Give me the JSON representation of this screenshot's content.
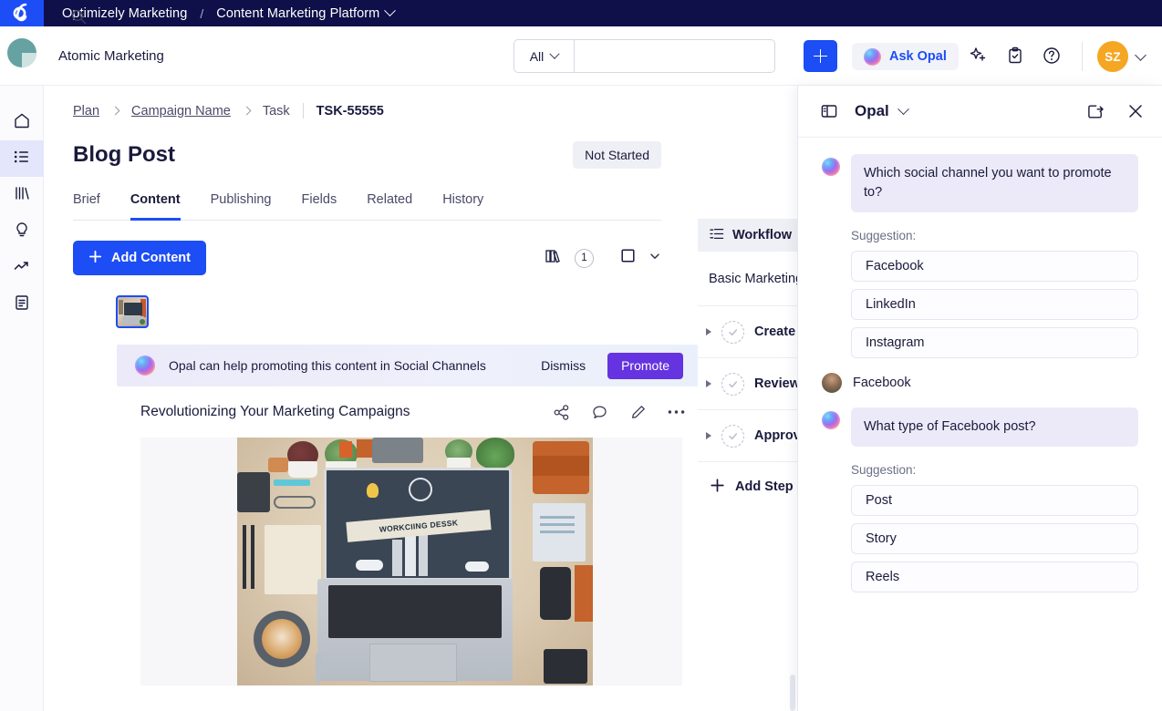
{
  "topnav": {
    "logo": "optimizely-logo",
    "org": "Optimizely Marketing",
    "separator": "/",
    "product": "Content Marketing Platform"
  },
  "appheader": {
    "workspace": "Atomic Marketing",
    "search": {
      "scope": "All",
      "value": "",
      "placeholder": ""
    },
    "add_label": "+",
    "ask_opal": "Ask Opal",
    "icons": [
      "sparkle-icon",
      "clipboard-check-icon",
      "help-circle-icon"
    ],
    "avatar_initials": "SZ"
  },
  "rail": {
    "items": [
      {
        "name": "home-icon",
        "active": false
      },
      {
        "name": "list-icon",
        "active": true
      },
      {
        "name": "library-icon",
        "active": false
      },
      {
        "name": "lightbulb-icon",
        "active": false
      },
      {
        "name": "trending-icon",
        "active": false
      },
      {
        "name": "document-icon",
        "active": false
      }
    ]
  },
  "main": {
    "breadcrumb": {
      "plan": "Plan",
      "campaign": "Campaign Name",
      "task": "Task",
      "id": "TSK-55555"
    },
    "page_title": "Blog Post",
    "status": "Not Started",
    "tabs": [
      {
        "label": "Brief",
        "active": false
      },
      {
        "label": "Content",
        "active": true
      },
      {
        "label": "Publishing",
        "active": false
      },
      {
        "label": "Fields",
        "active": false
      },
      {
        "label": "Related",
        "active": false
      },
      {
        "label": "History",
        "active": false
      }
    ],
    "add_content": "Add Content",
    "library_count": "1",
    "promo": {
      "text": "Opal can help promoting this content in Social Channels",
      "dismiss": "Dismiss",
      "promote": "Promote"
    },
    "content": {
      "title": "Revolutionizing Your Marketing Campaigns",
      "icons": [
        "share-icon",
        "comment-icon",
        "edit-pencil-icon",
        "more-dots-icon"
      ],
      "image_caption": "WORKCIING DESSK"
    }
  },
  "workflow": {
    "tab_label": "Workflow",
    "subtitle": "Basic Marketing",
    "steps": [
      {
        "label": "Create"
      },
      {
        "label": "Review"
      },
      {
        "label": "Approve"
      }
    ],
    "add_step": "Add Step"
  },
  "opal": {
    "title": "Opal",
    "header_icons": [
      "panel-toggle-icon",
      "pop-out-icon",
      "close-icon"
    ],
    "thread": [
      {
        "role": "assistant",
        "text": "Which social channel you want to promote to?",
        "suggestion_label": "Suggestion:",
        "suggestions": [
          "Facebook",
          "LinkedIn",
          "Instagram"
        ]
      },
      {
        "role": "user",
        "text": "Facebook"
      },
      {
        "role": "assistant",
        "text": "What type of Facebook post?",
        "suggestion_label": "Suggestion:",
        "suggestions": [
          "Post",
          "Story",
          "Reels"
        ]
      }
    ]
  },
  "colors": {
    "nav_navy": "#0f1049",
    "brand_blue": "#1c4df5",
    "promote_purple": "#6533e0",
    "avatar_orange": "#f5a623",
    "bubble_lavender": "#eceaf8"
  }
}
